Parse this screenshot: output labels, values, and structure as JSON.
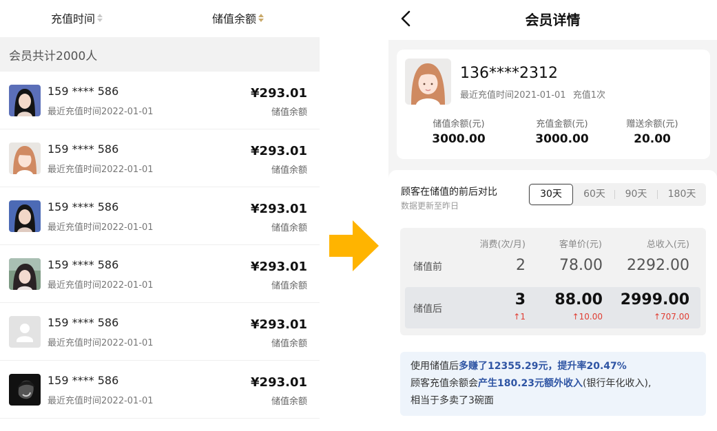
{
  "left": {
    "sort_time_label": "充值时间",
    "sort_balance_label": "储值余额",
    "count_text": "会员共计2000人",
    "members": [
      {
        "phone": "159 **** 586",
        "date": "最近充值时间2022-01-01",
        "amount": "¥293.01",
        "amount_label": "储值余额"
      },
      {
        "phone": "159 **** 586",
        "date": "最近充值时间2022-01-01",
        "amount": "¥293.01",
        "amount_label": "储值余额"
      },
      {
        "phone": "159 **** 586",
        "date": "最近充值时间2022-01-01",
        "amount": "¥293.01",
        "amount_label": "储值余额"
      },
      {
        "phone": "159 **** 586",
        "date": "最近充值时间2022-01-01",
        "amount": "¥293.01",
        "amount_label": "储值余额"
      },
      {
        "phone": "159 **** 586",
        "date": "最近充值时间2022-01-01",
        "amount": "¥293.01",
        "amount_label": "储值余额"
      },
      {
        "phone": "159 **** 586",
        "date": "最近充值时间2022-01-01",
        "amount": "¥293.01",
        "amount_label": "储值余额"
      }
    ]
  },
  "right": {
    "title": "会员详情",
    "profile": {
      "phone": "136****2312",
      "last_recharge": "最近充值时间2021-01-01",
      "recharge_count": "充值1次",
      "stats": [
        {
          "label": "储值余额(元)",
          "value": "3000.00"
        },
        {
          "label": "充值金额(元)",
          "value": "3000.00"
        },
        {
          "label": "赠送余额(元)",
          "value": "20.00"
        }
      ]
    },
    "compare": {
      "title": "顾客在储值的前后对比",
      "subtitle": "数据更新至昨日",
      "tabs": [
        "30天",
        "60天",
        "90天",
        "180天"
      ],
      "active_tab": "30天",
      "headers": [
        "消费(次/月)",
        "客单价(元)",
        "总收入(元)"
      ],
      "before_label": "储值前",
      "before": [
        "2",
        "78.00",
        "2292.00"
      ],
      "after_label": "储值后",
      "after": [
        "3",
        "88.00",
        "2999.00"
      ],
      "delta": [
        "↑1",
        "↑10.00",
        "↑707.00"
      ]
    },
    "note": {
      "l1a": "使用储值后",
      "l1b": "多赚了12355.29元，提升率20.47%",
      "l2a": "顾客充值余额会",
      "l2b": "产生180.23元额外收入",
      "l2c": "(银行年化收入),",
      "l3": "相当于多卖了3碗面"
    }
  },
  "colors": {
    "accent_gold": "#c9a96a",
    "arrow_yellow": "#ffb400",
    "up_red": "#e03c31",
    "highlight_blue": "#2f55a4"
  }
}
